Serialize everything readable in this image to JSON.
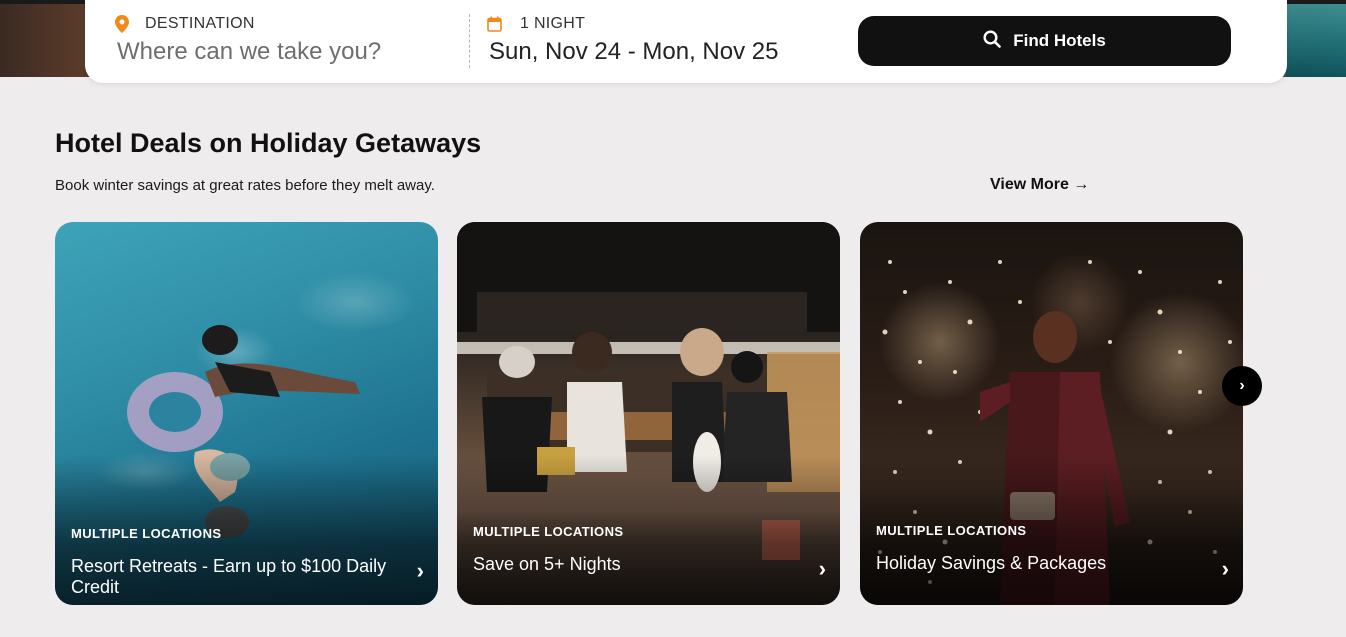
{
  "search": {
    "destination_label": "DESTINATION",
    "destination_placeholder": "Where can we take you?",
    "nights_label": "1 NIGHT",
    "dates_value": "Sun, Nov 24 - Mon, Nov 25",
    "find_button_label": "Find Hotels",
    "accent_color": "#f08a1c"
  },
  "section": {
    "title": "Hotel Deals on Holiday Getaways",
    "subtitle": "Book winter savings at great rates before they melt away.",
    "view_more_label": "View More →"
  },
  "cards": [
    {
      "location": "MULTIPLE LOCATIONS",
      "title": "Resort Retreats - Earn up to $100 Daily Credit",
      "chevron": "›",
      "image": "pool-floating-women"
    },
    {
      "location": "MULTIPLE LOCATIONS",
      "title": "Save on 5+ Nights",
      "chevron": "›",
      "image": "friends-by-fireplace"
    },
    {
      "location": "MULTIPLE LOCATIONS",
      "title": "Holiday Savings & Packages",
      "chevron": "›",
      "image": "woman-holiday-lights"
    }
  ],
  "carousel": {
    "next_label": "›"
  }
}
